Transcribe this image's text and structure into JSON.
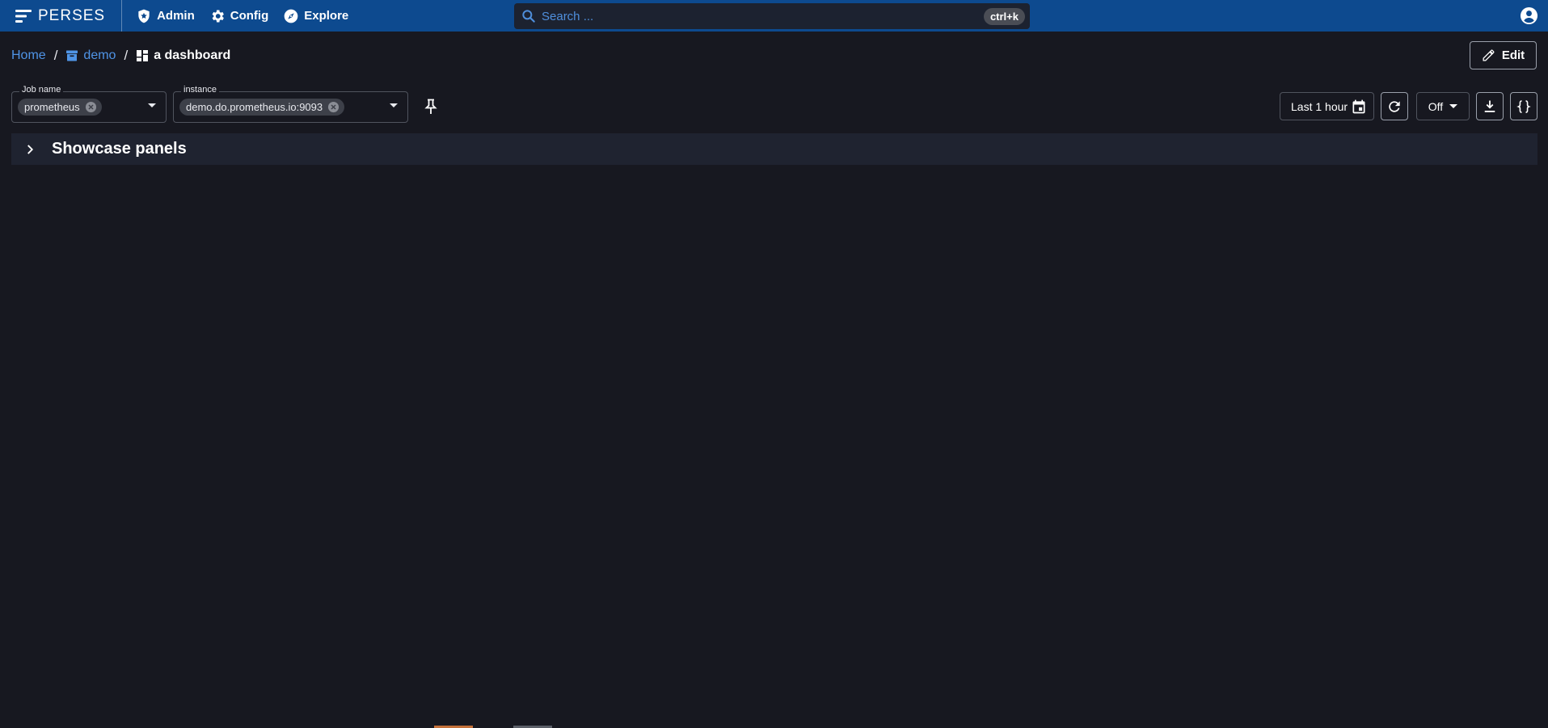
{
  "app": {
    "brand": "PERSES"
  },
  "nav": {
    "admin": "Admin",
    "config": "Config",
    "explore": "Explore"
  },
  "search": {
    "placeholder": "Search ...",
    "shortcut": "ctrl+k"
  },
  "breadcrumb": {
    "home": "Home",
    "project": "demo",
    "dashboard": "a dashboard",
    "separator": "/"
  },
  "actions": {
    "edit": "Edit"
  },
  "variables": [
    {
      "label": "Job name",
      "value": "prometheus"
    },
    {
      "label": "instance",
      "value": "demo.do.prometheus.io:9093"
    }
  ],
  "controls": {
    "time_range": "Last 1 hour",
    "refresh_interval": "Off"
  },
  "panel_group": {
    "title": "Showcase panels",
    "expanded": false
  },
  "colors": {
    "topbar": "#0d4a8f",
    "background": "#171820",
    "link": "#4f94e6",
    "panel_group_bg": "#1f2330"
  }
}
